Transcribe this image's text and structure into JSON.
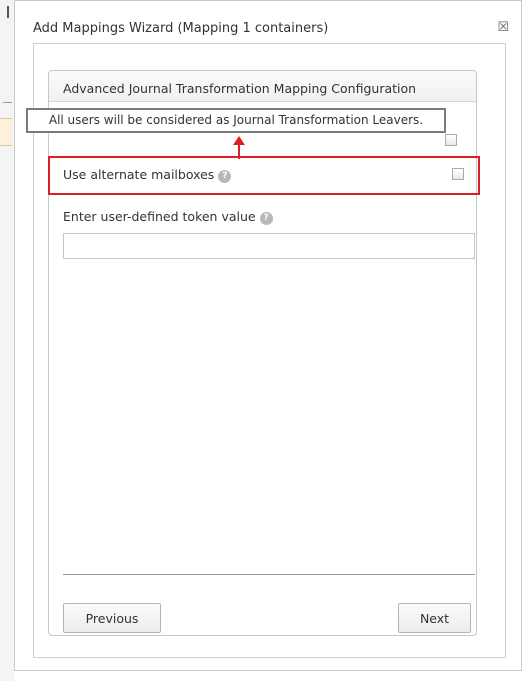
{
  "dialog": {
    "title": "Add Mappings Wizard (Mapping 1 containers)",
    "close_glyph": "☒"
  },
  "panel": {
    "title": "Advanced Journal Transformation Mapping Configuration"
  },
  "options": {
    "alternate_mailboxes": {
      "label": "Use alternate mailboxes",
      "help_icon": "question-icon",
      "checked": false
    },
    "token": {
      "label": "Enter user-defined token value",
      "help_icon": "question-icon",
      "value": ""
    }
  },
  "tooltip": {
    "text": "All users will be considered as Journal Transformation Leavers."
  },
  "buttons": {
    "previous": "Previous",
    "next": "Next"
  },
  "colors": {
    "annotation": "#d92027",
    "tooltip_border": "#7a7a7a",
    "help_icon": "#b8b8b8"
  }
}
